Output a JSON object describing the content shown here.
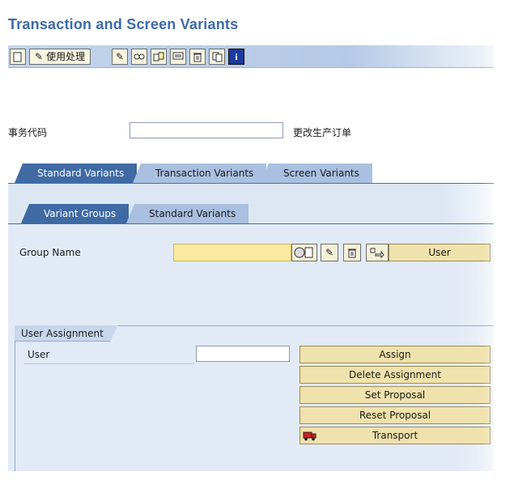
{
  "title": "Transaction and Screen Variants",
  "toolbar": {
    "usage_label": "使用处理",
    "icons": [
      "create-icon",
      "edit-icon",
      "pencil-icon",
      "glasses-icon",
      "copy-icon",
      "screen-icon",
      "delete-icon",
      "duplicate-icon",
      "info-icon"
    ]
  },
  "transaction": {
    "label": "事务代码",
    "value": "",
    "description": "更改生产订单"
  },
  "tabs_main": [
    "Standard Variants",
    "Transaction Variants",
    "Screen Variants"
  ],
  "tabs_sub": [
    "Variant Groups",
    "Standard Variants"
  ],
  "group": {
    "label": "Group Name",
    "value": "",
    "user_button": "User"
  },
  "user_assignment": {
    "title": "User Assignment",
    "user_label": "User",
    "user_value": "",
    "assign_label": "Assign",
    "delete_label": "Delete Assignment",
    "set_label": "Set Proposal",
    "reset_label": "Reset Proposal",
    "transport_label": "Transport"
  },
  "colors": {
    "title": "#3d6aa8",
    "active_tab": "#3f6aa3",
    "inactive_tab": "#a9c0e0",
    "required_field": "#fbeaa0",
    "action_button": "#f0e2ac"
  }
}
